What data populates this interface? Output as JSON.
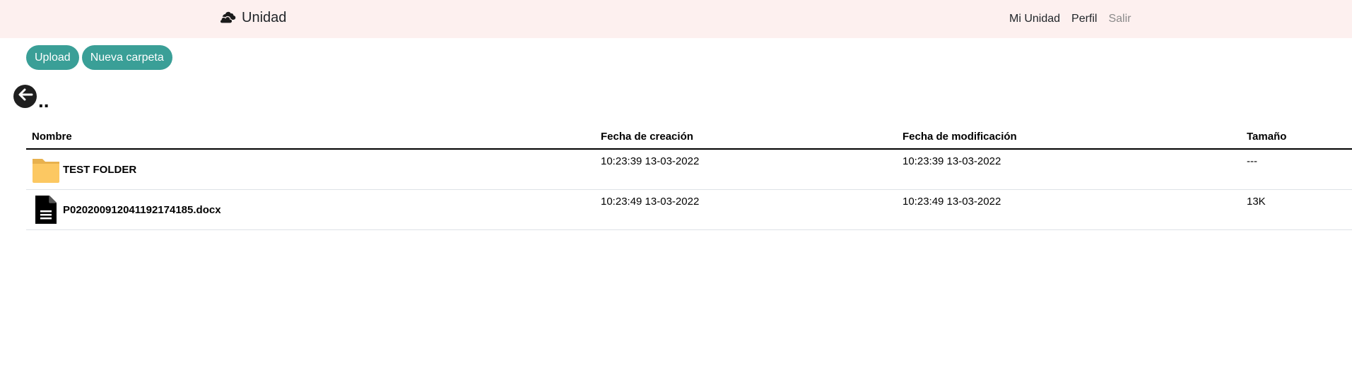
{
  "navbar": {
    "brand_label": "Unidad",
    "brand_icon": "clouds-icon",
    "links": [
      {
        "label": "Mi Unidad"
      },
      {
        "label": "Perfil"
      },
      {
        "label": "Salir"
      }
    ],
    "background": "#fdf0ef"
  },
  "actions": {
    "upload_label": "Upload",
    "new_folder_label": "Nueva carpeta",
    "accent": "#3a9f97"
  },
  "navigation": {
    "parent_label": "..",
    "back_icon": "arrow-left-circle-icon"
  },
  "table": {
    "headers": {
      "name": "Nombre",
      "created": "Fecha de creación",
      "modified": "Fecha de modificación",
      "size": "Tamaño"
    },
    "rows": [
      {
        "icon": "folder-icon",
        "name": "TEST FOLDER",
        "created": "10:23:39 13-03-2022",
        "modified": "10:23:39 13-03-2022",
        "size": "---"
      },
      {
        "icon": "file-document-icon",
        "name": "P020200912041192174185.docx",
        "created": "10:23:49 13-03-2022",
        "modified": "10:23:49 13-03-2022",
        "size": "13K"
      }
    ]
  }
}
